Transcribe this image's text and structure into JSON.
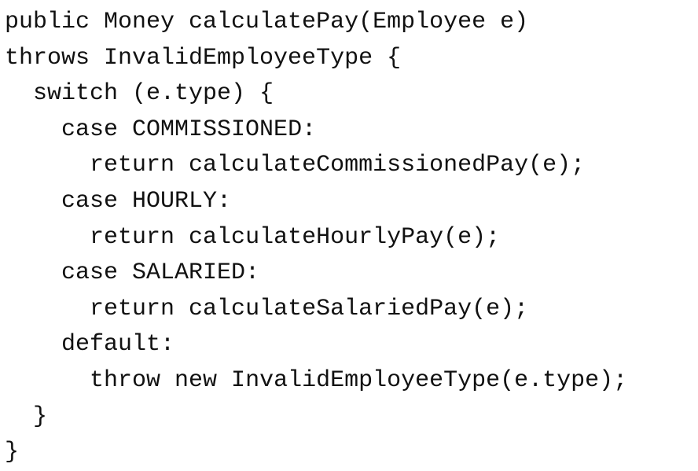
{
  "code": {
    "lines": [
      {
        "indent": "",
        "text": "public Money calculatePay(Employee e)"
      },
      {
        "indent": "",
        "text": "throws InvalidEmployeeType {"
      },
      {
        "indent": "  ",
        "text": "switch (e.type) {"
      },
      {
        "indent": "    ",
        "text": "case COMMISSIONED:"
      },
      {
        "indent": "      ",
        "text": "return calculateCommissionedPay(e);"
      },
      {
        "indent": "    ",
        "text": "case HOURLY:"
      },
      {
        "indent": "      ",
        "text": "return calculateHourlyPay(e);"
      },
      {
        "indent": "    ",
        "text": "case SALARIED:"
      },
      {
        "indent": "      ",
        "text": "return calculateSalariedPay(e);"
      },
      {
        "indent": "    ",
        "text": "default:"
      },
      {
        "indent": "      ",
        "text": "throw new InvalidEmployeeType(e.type);"
      },
      {
        "indent": "  ",
        "text": "}"
      },
      {
        "indent": "",
        "text": "}"
      }
    ]
  }
}
